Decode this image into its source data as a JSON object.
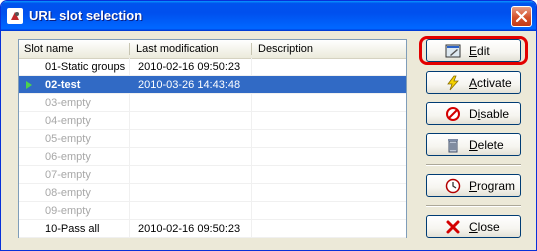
{
  "window": {
    "title": "URL slot selection",
    "accent": "#0053ee"
  },
  "list": {
    "columns": [
      "Slot name",
      "Last modification",
      "Description"
    ],
    "rows": [
      {
        "name": "01-Static groups",
        "modified": "2010-02-16 09:50:23",
        "description": "",
        "state": "normal"
      },
      {
        "name": "02-test",
        "modified": "2010-03-26 14:43:48",
        "description": "",
        "state": "selected"
      },
      {
        "name": "03-empty",
        "modified": "",
        "description": "",
        "state": "empty"
      },
      {
        "name": "04-empty",
        "modified": "",
        "description": "",
        "state": "empty"
      },
      {
        "name": "05-empty",
        "modified": "",
        "description": "",
        "state": "empty"
      },
      {
        "name": "06-empty",
        "modified": "",
        "description": "",
        "state": "empty"
      },
      {
        "name": "07-empty",
        "modified": "",
        "description": "",
        "state": "empty"
      },
      {
        "name": "08-empty",
        "modified": "",
        "description": "",
        "state": "empty"
      },
      {
        "name": "09-empty",
        "modified": "",
        "description": "",
        "state": "empty"
      },
      {
        "name": "10-Pass all",
        "modified": "2010-02-16 09:50:23",
        "description": "",
        "state": "normal"
      }
    ]
  },
  "buttons": {
    "edit": {
      "pre": "",
      "acc": "E",
      "post": "dit",
      "icon": "edit-icon",
      "highlighted": true
    },
    "activate": {
      "pre": "",
      "acc": "A",
      "post": "ctivate",
      "icon": "lightning-icon"
    },
    "disable": {
      "pre": "D",
      "acc": "i",
      "post": "sable",
      "icon": "no-entry-icon"
    },
    "delete": {
      "pre": "",
      "acc": "D",
      "post": "elete",
      "icon": "trash-icon"
    },
    "program": {
      "pre": "",
      "acc": "P",
      "post": "rogram",
      "icon": "clock-icon"
    },
    "close": {
      "pre": "",
      "acc": "C",
      "post": "lose",
      "icon": "x-icon"
    }
  }
}
